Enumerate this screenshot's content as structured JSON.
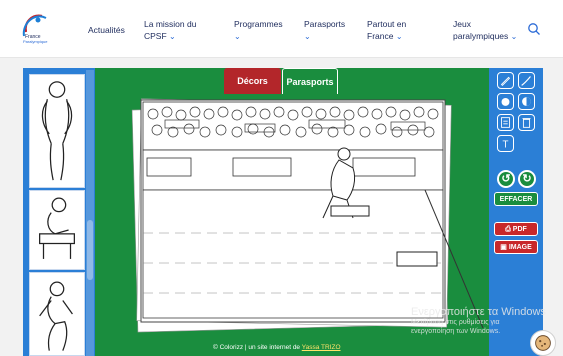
{
  "header": {
    "logo_alt": "France Paralympique",
    "nav": [
      {
        "label": "Actualités",
        "has_dropdown": false
      },
      {
        "label": "La mission du CPSF",
        "has_dropdown": true
      },
      {
        "label": "Programmes",
        "has_dropdown": true
      },
      {
        "label": "Parasports",
        "has_dropdown": true
      },
      {
        "label": "Partout en France",
        "has_dropdown": true
      },
      {
        "label": "Jeux paralympiques",
        "has_dropdown": true
      }
    ],
    "search_icon": "search-icon"
  },
  "coloring_app": {
    "tabs": [
      {
        "label": "Décors",
        "active": true
      },
      {
        "label": "Parasports",
        "active": false
      }
    ],
    "left_thumbnails": [
      "swimmer-standing",
      "athlete-wheelchair",
      "runner-starting-block"
    ],
    "tools": [
      "pen-tool-icon",
      "brush-tool-icon",
      "fill-tool-icon",
      "gradient-tool-icon",
      "sticker-tool-icon",
      "trash-tool-icon",
      "text-tool-icon"
    ],
    "undo_icon": "undo-icon",
    "redo_icon": "redo-icon",
    "effacer_label": "EFFACER",
    "pdf_label": "PDF",
    "image_label": "IMAGE",
    "credit_prefix": "© Colorizz | un site internet de",
    "credit_link": "Yassa TRIZO"
  },
  "windows_notice": {
    "title": "Ενεργοποιήστε τα Windows",
    "line1": "Μετάβαση στις ρυθμίσεις για",
    "line2": "ενεργοποίηση των Windows."
  },
  "colors": {
    "canvas_green": "#1a8d3e",
    "panel_blue": "#2b7fd6",
    "tab_red": "#b3262a",
    "nav_text": "#1d2b5c"
  }
}
